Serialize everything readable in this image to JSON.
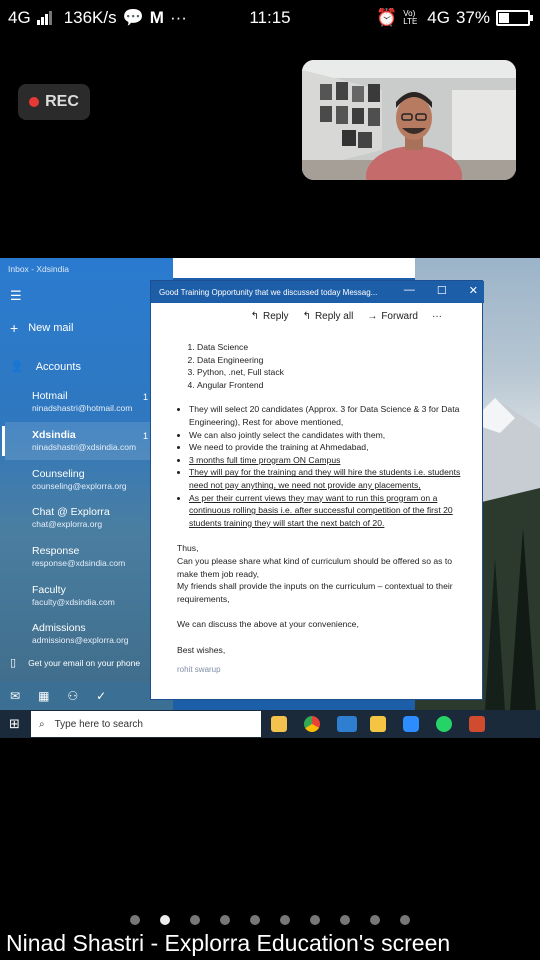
{
  "status_bar": {
    "network": "4G",
    "speed": "136K/s",
    "time": "11:15",
    "network_right": "4G",
    "volte": "Vo) LTE",
    "battery_percent": "37%",
    "battery_level": 0.37
  },
  "rec_label": "REC",
  "shared_screen": {
    "mail": {
      "window_title": "Inbox - Xdsindia",
      "new_mail": "New mail",
      "accounts_heading": "Accounts",
      "accounts": [
        {
          "name": "Hotmail",
          "email": "ninadshastri@hotmail.com",
          "count": "1"
        },
        {
          "name": "Xdsindia",
          "email": "ninadshastri@xdsindia.com",
          "count": "1"
        },
        {
          "name": "Counseling",
          "email": "counseling@explorra.org",
          "count": ""
        },
        {
          "name": "Chat @ Explorra",
          "email": "chat@explorra.org",
          "count": ""
        },
        {
          "name": "Response",
          "email": "response@xdsindia.com",
          "count": ""
        },
        {
          "name": "Faculty",
          "email": "faculty@xdsindia.com",
          "count": ""
        },
        {
          "name": "Admissions",
          "email": "admissions@explorra.org",
          "count": ""
        }
      ],
      "phone_promo": "Get your email on your phone"
    },
    "message": {
      "title": "Good  Training Opportunity that we discussed today   Messag...",
      "reply": "Reply",
      "reply_all": "Reply all",
      "forward": "Forward",
      "more": "···",
      "numbered": [
        "Data Science",
        "Data Engineering",
        "Python, .net, Full stack",
        "Angular Frontend"
      ],
      "bullets": [
        "They will select 20 candidates (Approx. 3 for Data Science & 3 for Data Engineering), Rest for above mentioned,",
        "We can also jointly select the candidates with them,",
        "We need to provide the training at Ahmedabad,",
        "3 months full time program ON Campus",
        "They will pay for the training and they will hire the students i.e. students need not pay anything, we need not provide any placements,",
        "As per their current views they may want to run this program on a continuous rolling basis i.e. after successful competition of the first 20 students training they will start the next batch of 20."
      ],
      "thus": "Thus,",
      "para1": "Can you please share what kind of curriculum should be offered so as to make them job ready,",
      "para2": "My friends shall provide the inputs on the curriculum – contextual to their requirements,",
      "para3": "We can discuss the above at your convenience,",
      "closing": "Best wishes,",
      "signature": "rohit swarup"
    },
    "taskbar": {
      "search_placeholder": "Type here to search"
    }
  },
  "pager": {
    "count": 10,
    "active_index": 1
  },
  "caption": "Ninad Shastri - Explorra Education's screen"
}
